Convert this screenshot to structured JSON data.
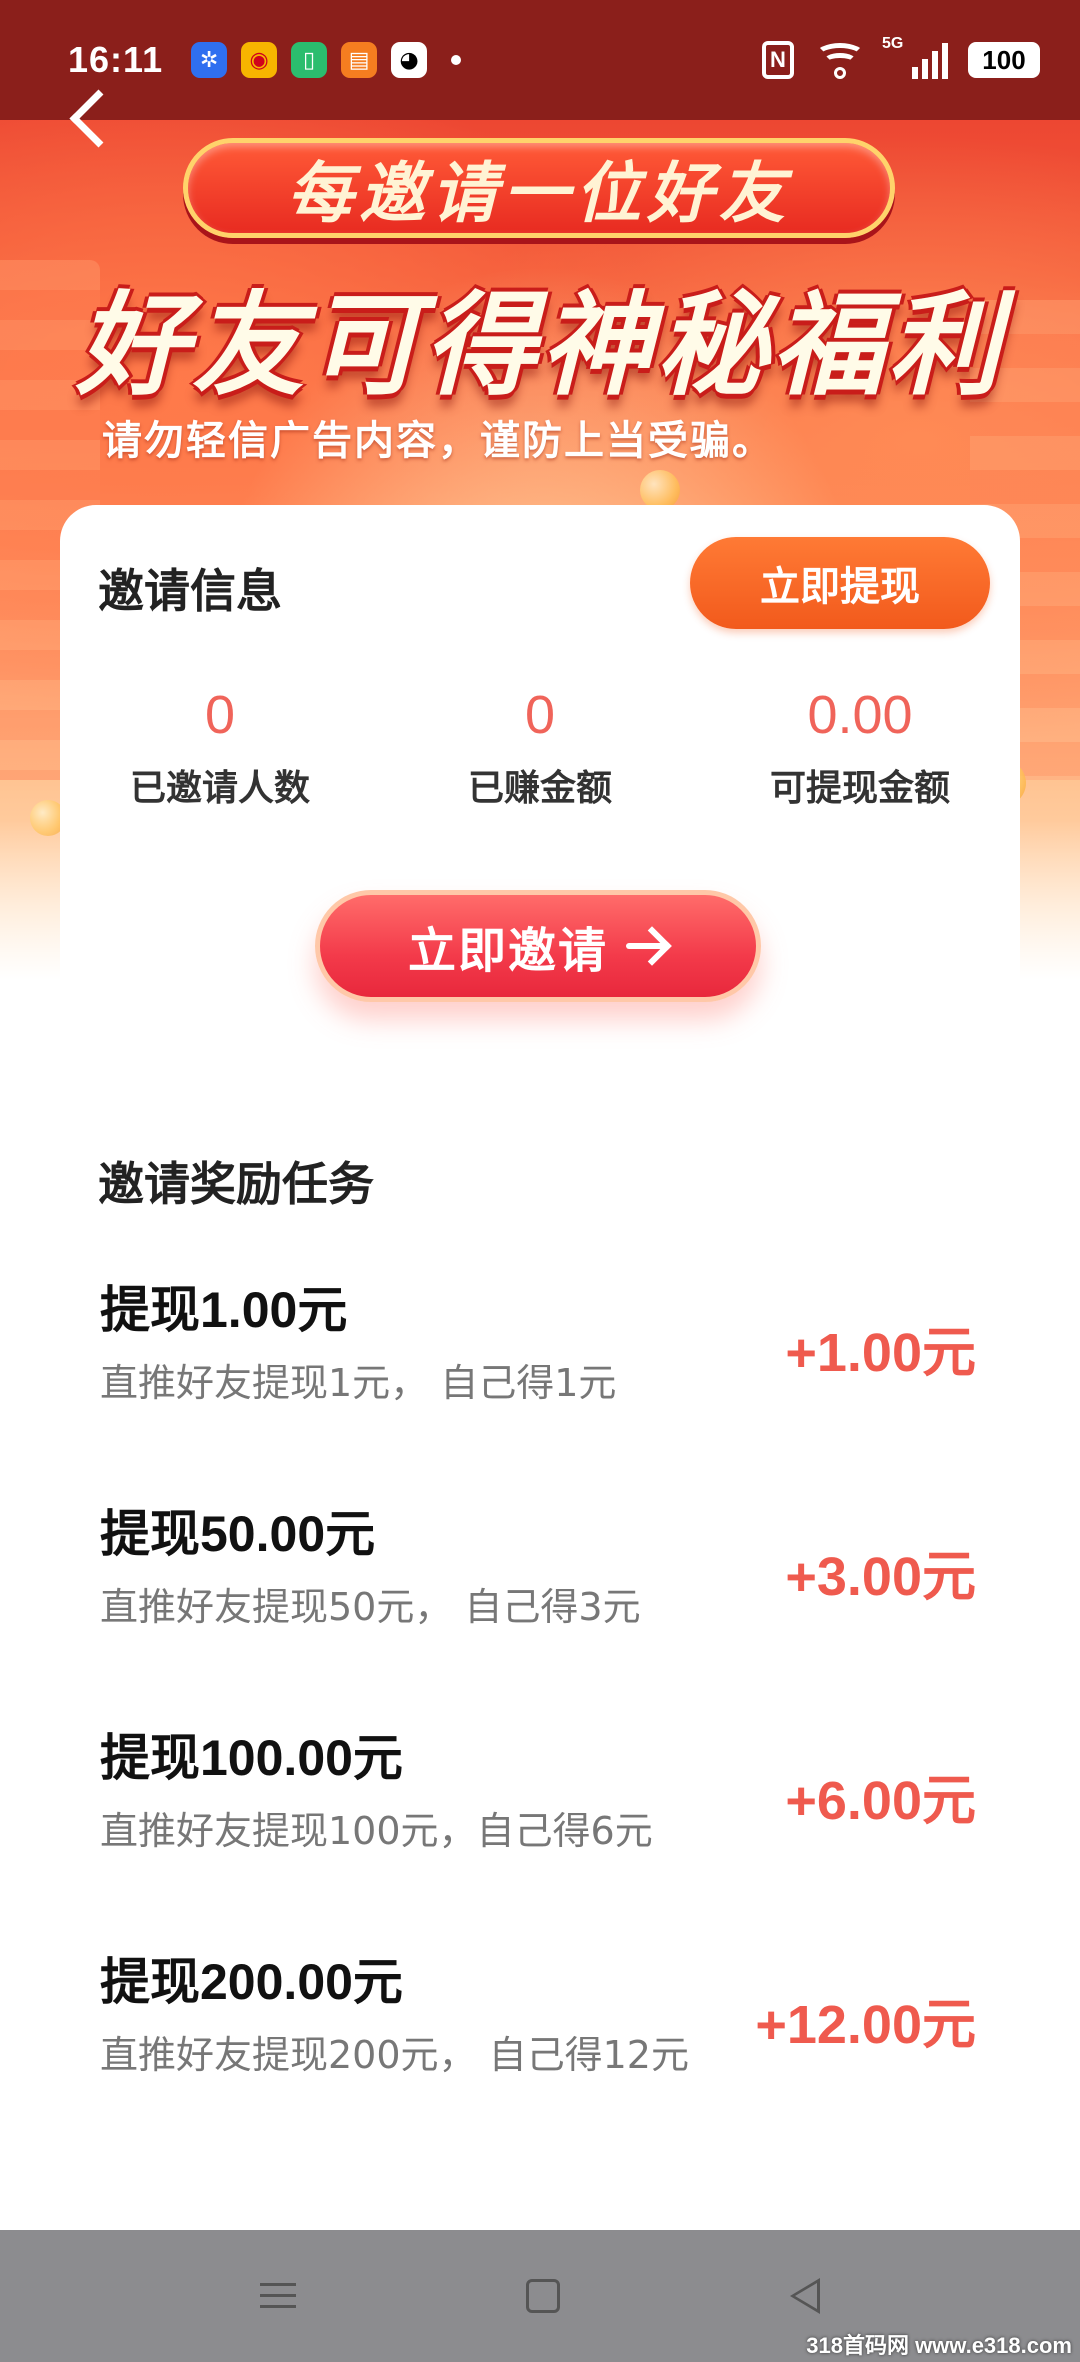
{
  "status_bar": {
    "time": "16:11",
    "battery": "100",
    "network": "5G",
    "apps": [
      {
        "icon": "pinwheel-app-icon",
        "color": "#2f6ff0"
      },
      {
        "icon": "weibo-app-icon",
        "color": "#f7b500"
      },
      {
        "icon": "battery-app-icon",
        "color": "#2bbd6e"
      },
      {
        "icon": "book-app-icon",
        "color": "#f57d20"
      },
      {
        "icon": "qq-app-icon",
        "color": "#ffffff"
      }
    ]
  },
  "hero": {
    "pill_title": "每邀请一位好友",
    "main_title": "好友可得神秘福利",
    "warning": "请勿轻信广告内容，谨防上当受骗。"
  },
  "invite_card": {
    "heading": "邀请信息",
    "withdraw_label": "立即提现",
    "stats": [
      {
        "value": "0",
        "label": "已邀请人数"
      },
      {
        "value": "0",
        "label": "已赚金额"
      },
      {
        "value": "0.00",
        "label": "可提现金额"
      }
    ],
    "invite_label": "立即邀请"
  },
  "tasks": {
    "heading": "邀请奖励任务",
    "items": [
      {
        "title": "提现1.00元",
        "desc": "直推好友提现1元， 自己得1元",
        "reward": "+1.00元"
      },
      {
        "title": "提现50.00元",
        "desc": "直推好友提现50元， 自己得3元",
        "reward": "+3.00元"
      },
      {
        "title": "提现100.00元",
        "desc": "直推好友提现100元，自己得6元",
        "reward": "+6.00元"
      },
      {
        "title": "提现200.00元",
        "desc": "直推好友提现200元， 自己得12元",
        "reward": "+12.00元"
      }
    ]
  },
  "colors": {
    "accent": "#ef5a4e",
    "withdraw": "#f25a1c",
    "status_bar_bg": "#8b1f1b"
  },
  "watermark": "318首码网 www.e318.com"
}
